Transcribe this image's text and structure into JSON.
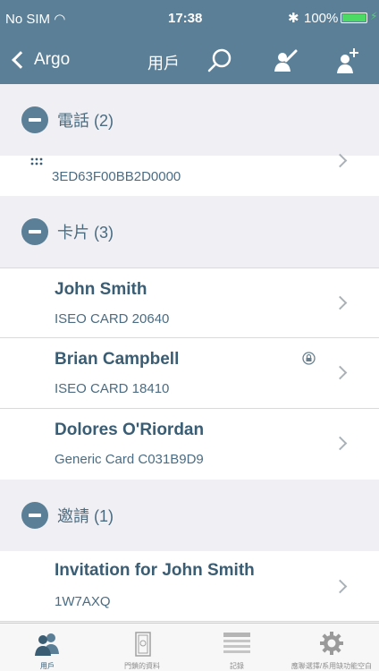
{
  "status_bar": {
    "carrier": "No SIM",
    "time": "17:38",
    "battery": "100%"
  },
  "nav": {
    "back_label": "Argo",
    "title": "用戶"
  },
  "sections": {
    "phones": {
      "label": "電話 (2)",
      "items": [
        {
          "subtitle": "3ED63F00BB2D0000"
        }
      ]
    },
    "cards": {
      "label": "卡片 (3)",
      "items": [
        {
          "title": "John Smith",
          "subtitle": "ISEO CARD 20640"
        },
        {
          "title": "Brian Campbell",
          "subtitle": "ISEO CARD 18410",
          "icon": "lock-icon"
        },
        {
          "title": "Dolores O'Riordan",
          "subtitle": "Generic Card C031B9D9"
        }
      ]
    },
    "invitations": {
      "label": "邀請 (1)",
      "items": [
        {
          "title": "Invitation for John Smith",
          "subtitle": "1W7AXQ"
        }
      ]
    }
  },
  "tab_bar": {
    "tabs": [
      {
        "label": "用戶",
        "icon": "users-icon",
        "active": true
      },
      {
        "label": "門鎖的資料",
        "icon": "door-icon",
        "active": false
      },
      {
        "label": "記錄",
        "icon": "log-list-icon",
        "active": false
      },
      {
        "label": "應聯選擇/系用缺功能空白",
        "icon": "gear-icon",
        "active": false
      }
    ]
  },
  "colors": {
    "header": "#5b7f96",
    "text_primary": "#3a5d74",
    "background": "#efeff4"
  }
}
